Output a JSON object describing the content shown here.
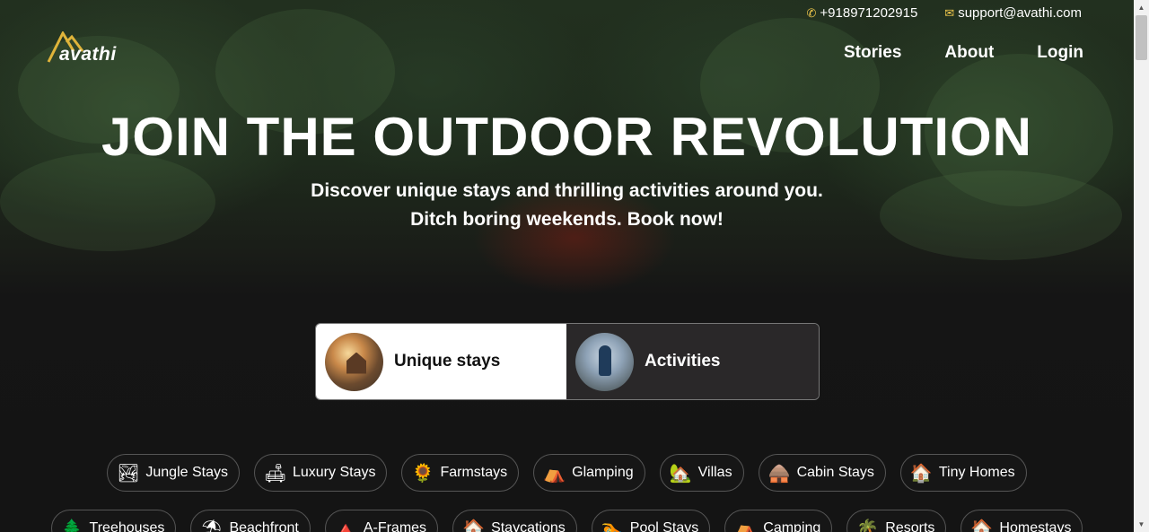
{
  "contact": {
    "phone": "+918971202915",
    "email": "support@avathi.com",
    "phone_icon": "phone-icon",
    "email_icon": "envelope-icon",
    "icon_color": "#f2c94c"
  },
  "logo": {
    "text": "avathi",
    "accent": "#e0b43a"
  },
  "nav": {
    "items": [
      "Stories",
      "About",
      "Login"
    ]
  },
  "hero": {
    "headline": "JOIN THE OUTDOOR REVOLUTION",
    "sub1": "Discover unique stays and thrilling activities around you.",
    "sub2": "Ditch boring weekends. Book now!"
  },
  "toggle": {
    "options": [
      {
        "label": "Unique stays",
        "active": true
      },
      {
        "label": "Activities",
        "active": false
      }
    ]
  },
  "categories_row1": [
    {
      "label": "Jungle Stays",
      "icon": "🏞"
    },
    {
      "label": "Luxury Stays",
      "icon": "🛋"
    },
    {
      "label": "Farmstays",
      "icon": "🌻"
    },
    {
      "label": "Glamping",
      "icon": "⛺"
    },
    {
      "label": "Villas",
      "icon": "🏡"
    },
    {
      "label": "Cabin Stays",
      "icon": "🛖"
    },
    {
      "label": "Tiny Homes",
      "icon": "🏠"
    }
  ],
  "categories_row2": [
    {
      "label": "Treehouses",
      "icon": "🌲"
    },
    {
      "label": "Beachfront",
      "icon": "⛱"
    },
    {
      "label": "A-Frames",
      "icon": "🔺"
    },
    {
      "label": "Staycations",
      "icon": "🏠"
    },
    {
      "label": "Pool Stays",
      "icon": "🏊"
    },
    {
      "label": "Camping",
      "icon": "⛺"
    },
    {
      "label": "Resorts",
      "icon": "🌴"
    },
    {
      "label": "Homestays",
      "icon": "🏠"
    }
  ]
}
